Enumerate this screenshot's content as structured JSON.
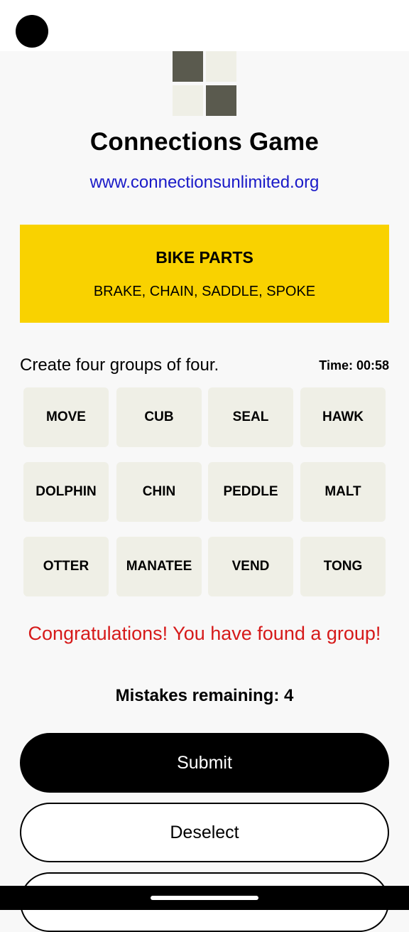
{
  "header": {
    "title": "Connections Game",
    "site_link": "www.connectionsunlimited.org"
  },
  "found_group": {
    "name": "BIKE PARTS",
    "words": "BRAKE, CHAIN, SADDLE, SPOKE",
    "color": "#f9d200"
  },
  "instructions": "Create four groups of four.",
  "timer": "Time: 00:58",
  "tiles": [
    "MOVE",
    "CUB",
    "SEAL",
    "HAWK",
    "DOLPHIN",
    "CHIN",
    "PEDDLE",
    "MALT",
    "OTTER",
    "MANATEE",
    "VEND",
    "TONG"
  ],
  "message": "Congratulations! You have found a group!",
  "mistakes": "Mistakes remaining: 4",
  "buttons": {
    "submit": "Submit",
    "deselect": "Deselect"
  },
  "colors": {
    "tile_bg": "#efefe6",
    "message_color": "#d61a1a",
    "link_color": "#1a1ac8"
  }
}
